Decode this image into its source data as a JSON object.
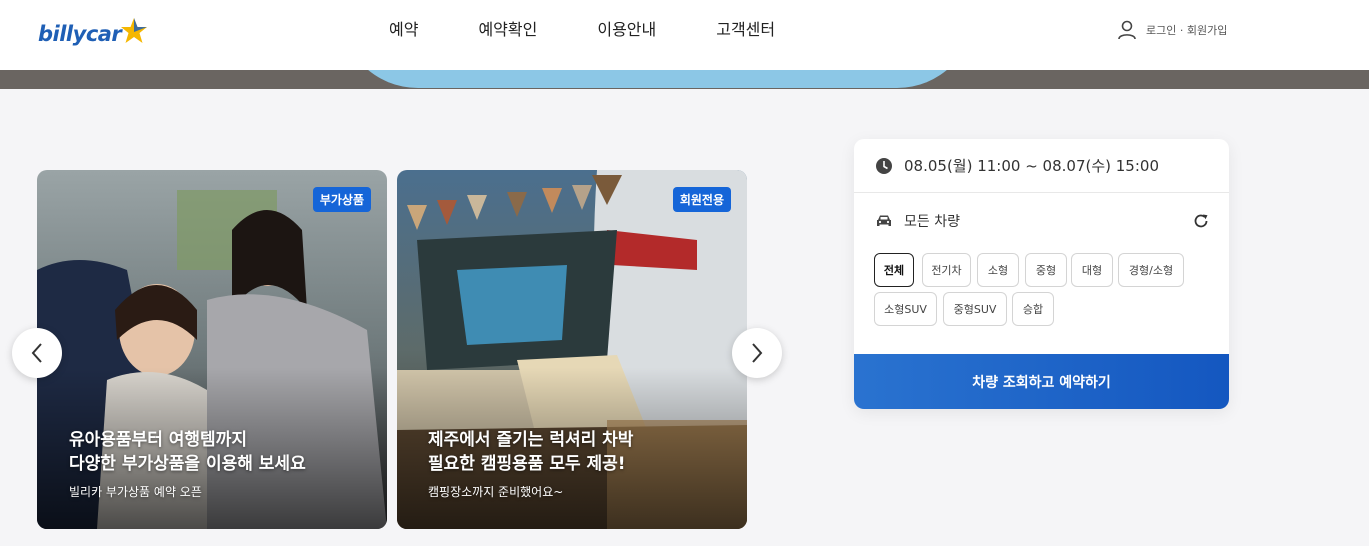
{
  "header": {
    "logo_text": "billycar",
    "nav": [
      "예약",
      "예약확인",
      "이용안내",
      "고객센터"
    ],
    "user_link": "로그인 · 회원가입"
  },
  "cards": [
    {
      "badge": "부가상품",
      "title": "유아용품부터 여행템까지\n다양한 부가상품을 이용해 보세요",
      "subtitle": "빌리카 부가상품 예약 오픈"
    },
    {
      "badge": "회원전용",
      "title": "제주에서 즐기는 럭셔리 차박\n필요한 캠핑용품 모두 제공!",
      "subtitle": "캠핑장소까지 준비했어요~"
    }
  ],
  "booking": {
    "date_range": "08.05(월) 11:00 ~ 08.07(수) 15:00",
    "car_type_label": "모든 차량",
    "chips": [
      "전체",
      "전기차",
      "소형",
      "중형",
      "대형",
      "경형/소형",
      "소형SUV",
      "중형SUV",
      "승합"
    ],
    "active_chip": "전체",
    "submit_label": "차량 조회하고 예약하기"
  },
  "colors": {
    "brand": "#1f5fb5",
    "accent_star": "#f5b700",
    "badge": "#1565d8",
    "button": "#1a62c9"
  },
  "icons": {
    "user": "user-icon",
    "clock": "clock-icon",
    "car": "car-icon",
    "refresh": "refresh-icon",
    "prev": "chevron-left-icon",
    "next": "chevron-right-icon"
  }
}
